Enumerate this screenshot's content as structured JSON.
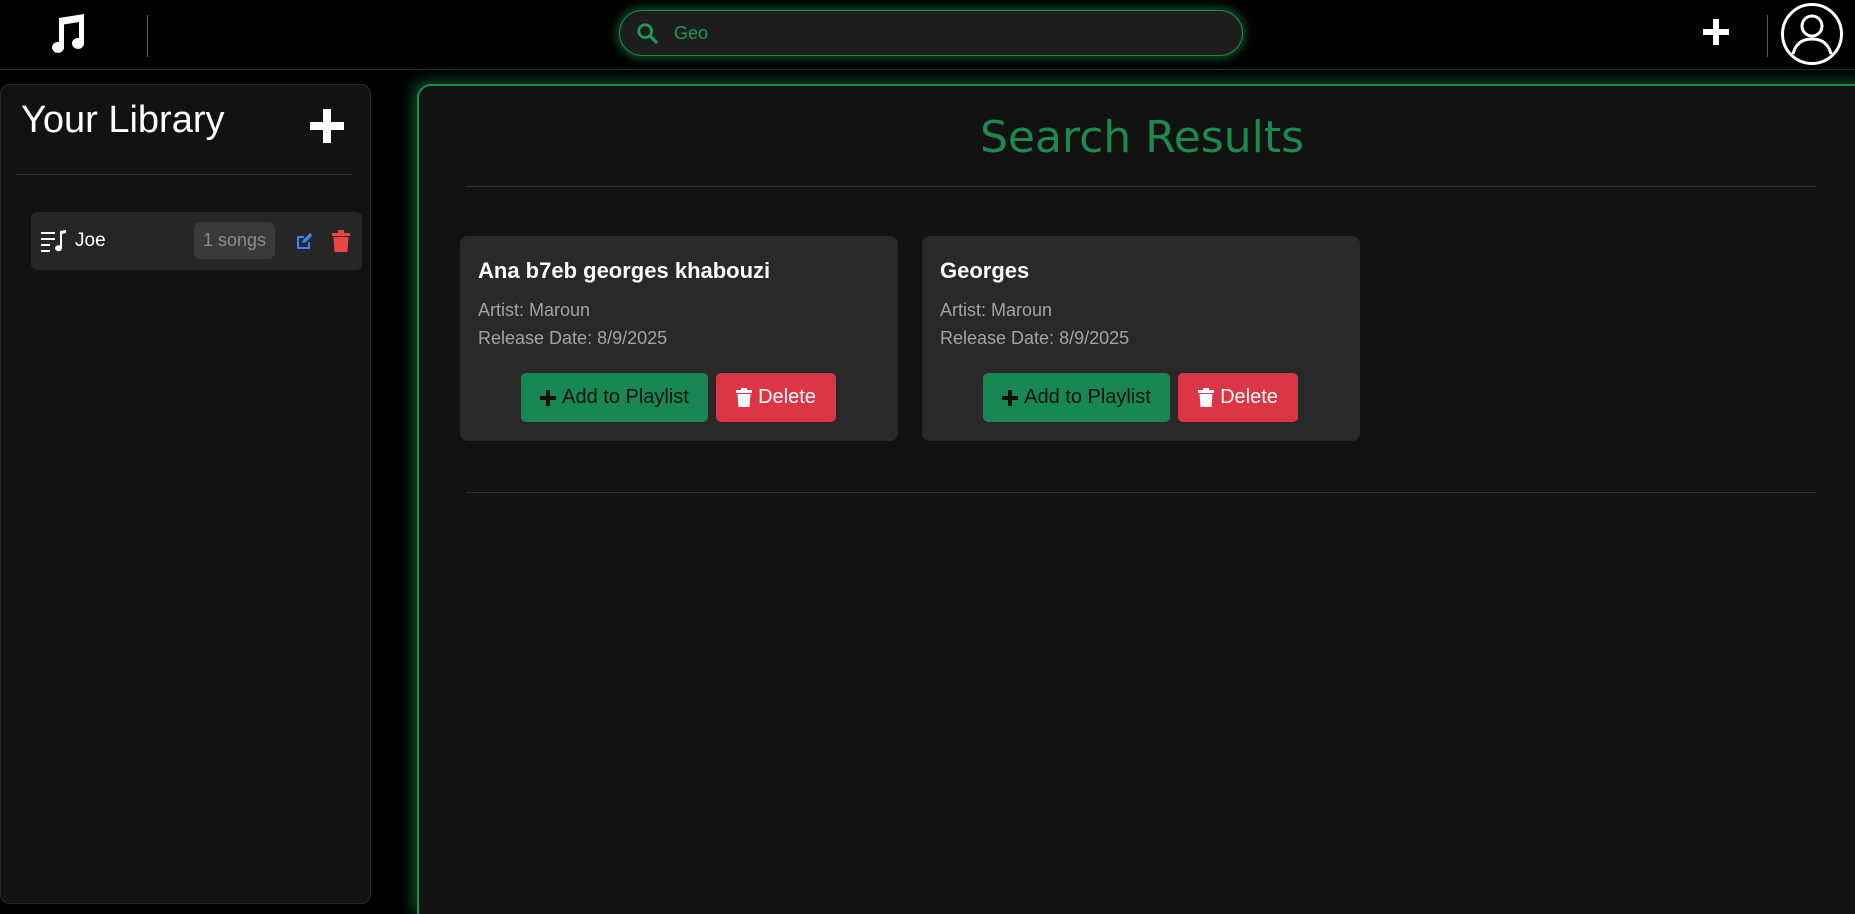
{
  "search": {
    "value": "",
    "placeholder": "Geo"
  },
  "sidebar": {
    "title": "Your Library",
    "playlists": [
      {
        "name": "Joe",
        "count": "1 songs"
      }
    ]
  },
  "main": {
    "title": "Search Results",
    "results": [
      {
        "title": "Ana b7eb georges khabouzi",
        "artist": "Artist: Maroun",
        "release": "Release Date: 8/9/2025",
        "add_label": "Add to Playlist",
        "delete_label": "Delete"
      },
      {
        "title": "Georges",
        "artist": "Artist: Maroun",
        "release": "Release Date: 8/9/2025",
        "add_label": "Add to Playlist",
        "delete_label": "Delete"
      }
    ]
  },
  "icons": {
    "logo": "music-note-icon",
    "search": "search-icon",
    "add": "plus-icon",
    "avatar": "user-circle-icon",
    "playlist": "playlist-icon",
    "edit": "edit-icon",
    "delete": "trash-icon"
  },
  "colors": {
    "accent_green": "#198754",
    "danger_red": "#dc3545",
    "edit_blue": "#3b82f6",
    "background": "#121212"
  }
}
